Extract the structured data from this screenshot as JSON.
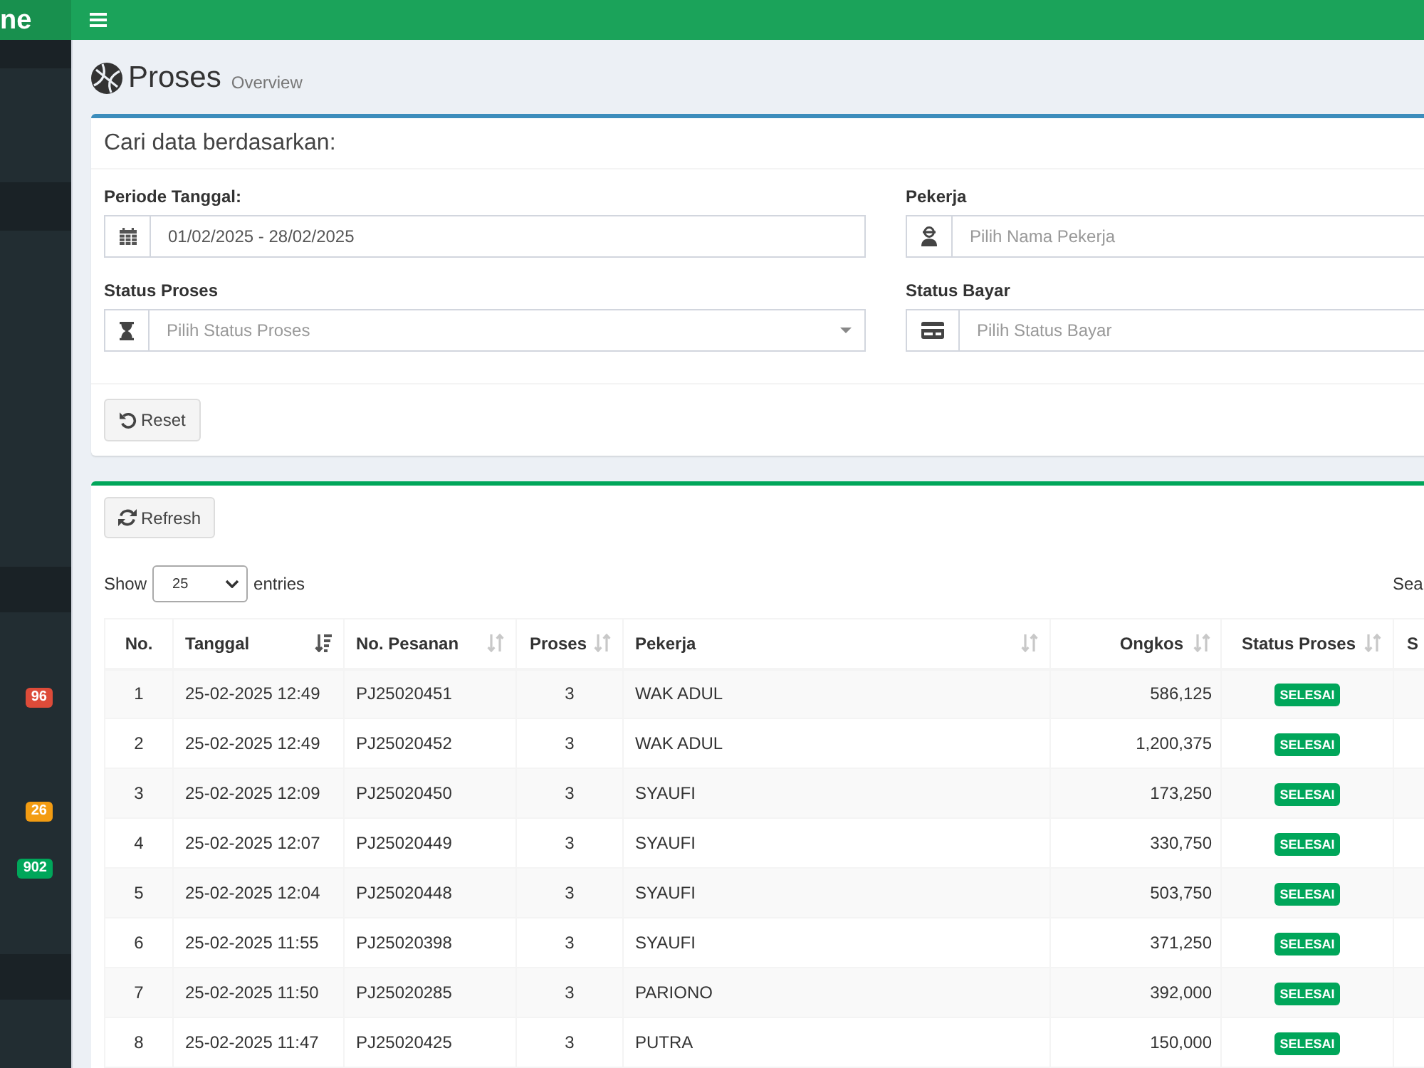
{
  "logo": {
    "text": "ne"
  },
  "sidebar": {
    "badges": [
      {
        "text": "96",
        "color": "#dd4b39"
      },
      {
        "text": "26",
        "color": "#f39c12"
      },
      {
        "text": "902",
        "color": "#00a65a"
      }
    ]
  },
  "page_header": {
    "title": "Proses",
    "subtitle": "Overview"
  },
  "filter_box": {
    "title": "Cari data berdasarkan:",
    "fields": [
      {
        "label": "Periode Tanggal:",
        "kind": "date_range",
        "value": "01/02/2025 - 28/02/2025"
      },
      {
        "label": "Pekerja",
        "kind": "text",
        "placeholder": "Pilih Nama Pekerja"
      },
      {
        "label": "Status Proses",
        "kind": "select",
        "placeholder": "Pilih Status Proses"
      },
      {
        "label": "Status Bayar",
        "kind": "text",
        "placeholder": "Pilih Status Bayar"
      }
    ],
    "reset_button": "Reset"
  },
  "data_box": {
    "refresh_button": "Refresh",
    "length_menu": {
      "label_before": "Show",
      "value": "25",
      "label_after": "entries"
    },
    "search_label": "Sea",
    "table": {
      "columns": [
        {
          "label": "No.",
          "kind": "index"
        },
        {
          "label": "Tanggal",
          "kind": "text",
          "sorted": true
        },
        {
          "label": "No. Pesanan",
          "kind": "text",
          "sorted": false
        },
        {
          "label": "Proses",
          "kind": "count",
          "sorted": false
        },
        {
          "label": "Pekerja",
          "kind": "text",
          "sorted": false
        },
        {
          "label": "Ongkos",
          "kind": "amount",
          "sorted": false
        },
        {
          "label": "Status Proses",
          "kind": "status",
          "sorted": false
        },
        {
          "label": "S",
          "kind": "edge"
        }
      ],
      "rows": [
        [
          "1",
          "25-02-2025 12:49",
          "PJ25020451",
          "3",
          "WAK ADUL",
          "586,125",
          "SELESAI"
        ],
        [
          "2",
          "25-02-2025 12:49",
          "PJ25020452",
          "3",
          "WAK ADUL",
          "1,200,375",
          "SELESAI"
        ],
        [
          "3",
          "25-02-2025 12:09",
          "PJ25020450",
          "3",
          "SYAUFI",
          "173,250",
          "SELESAI"
        ],
        [
          "4",
          "25-02-2025 12:07",
          "PJ25020449",
          "3",
          "SYAUFI",
          "330,750",
          "SELESAI"
        ],
        [
          "5",
          "25-02-2025 12:04",
          "PJ25020448",
          "3",
          "SYAUFI",
          "503,750",
          "SELESAI"
        ],
        [
          "6",
          "25-02-2025 11:55",
          "PJ25020398",
          "3",
          "SYAUFI",
          "371,250",
          "SELESAI"
        ],
        [
          "7",
          "25-02-2025 11:50",
          "PJ25020285",
          "3",
          "PARIONO",
          "392,000",
          "SELESAI"
        ],
        [
          "8",
          "25-02-2025 11:47",
          "PJ25020425",
          "3",
          "PUTRA",
          "150,000",
          "SELESAI"
        ]
      ]
    }
  }
}
